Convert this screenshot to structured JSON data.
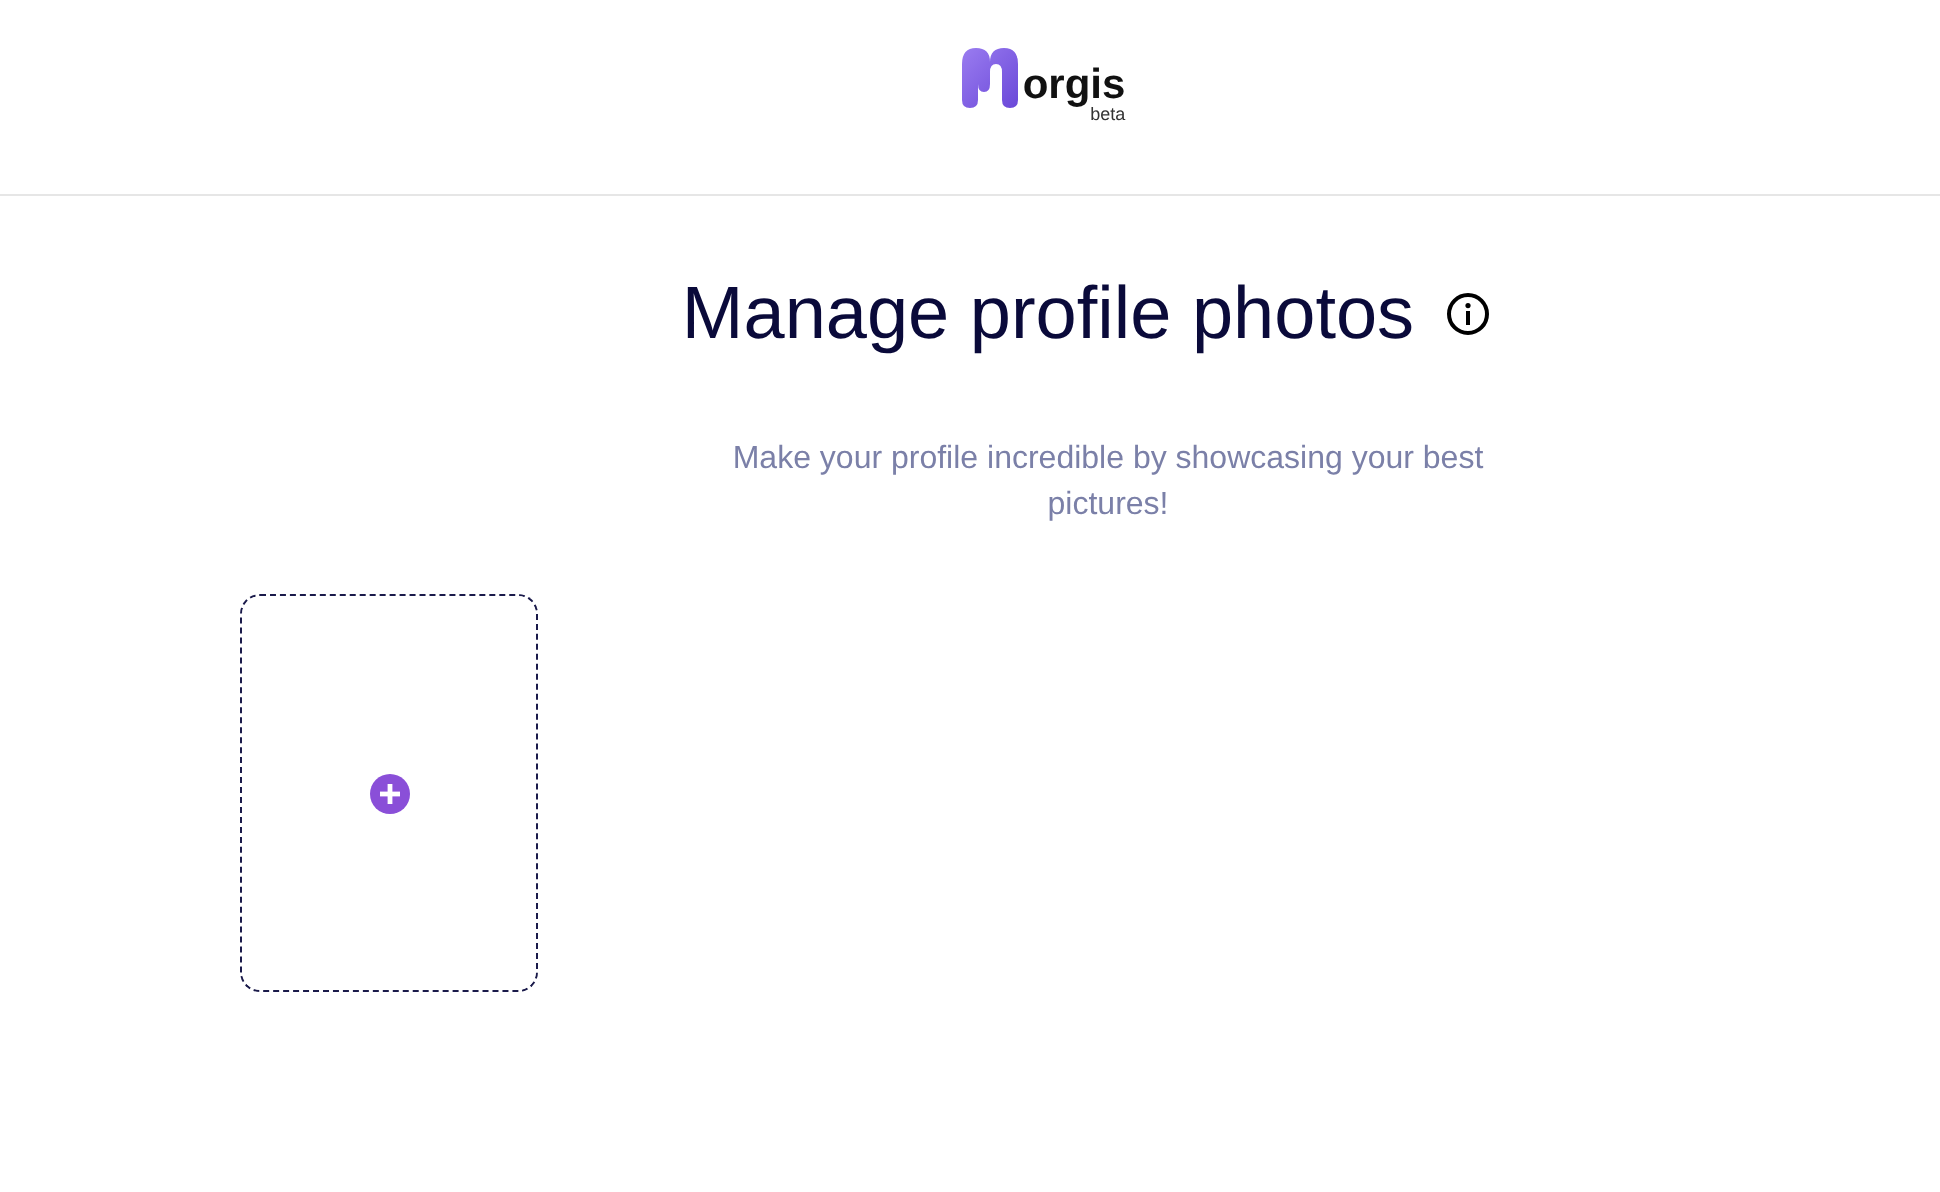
{
  "header": {
    "logo": {
      "name": "orgis",
      "tag": "beta"
    }
  },
  "title": "Manage profile photos",
  "subtitle": "Make your profile incredible by showcasing your best pictures!",
  "photo_slots": [
    {
      "kind": "add"
    }
  ]
}
